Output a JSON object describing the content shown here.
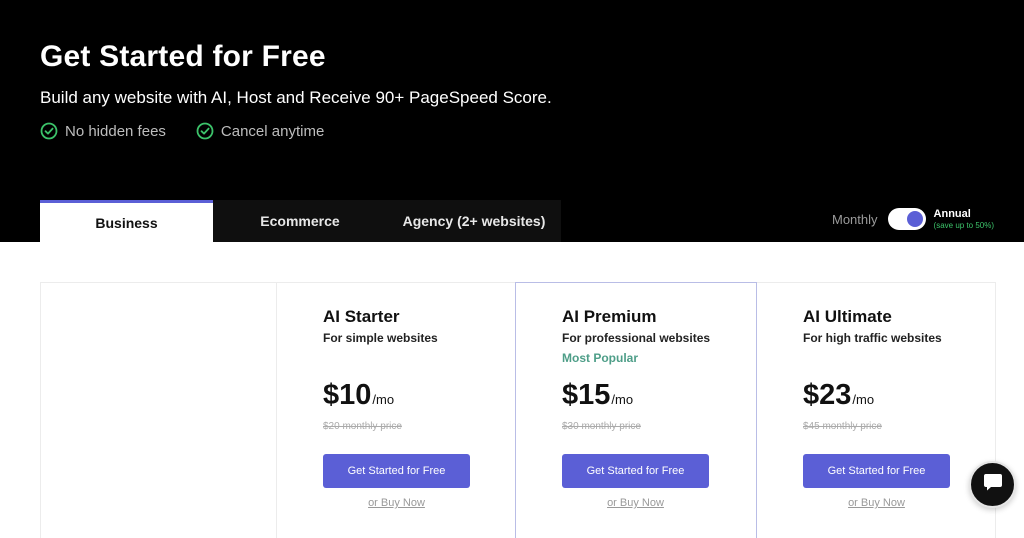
{
  "hero": {
    "title": "Get Started for Free",
    "subtitle": "Build any website with AI, Host and Receive 90+ PageSpeed Score.",
    "features": [
      {
        "label": "No hidden fees",
        "icon": "check-circle-icon"
      },
      {
        "label": "Cancel anytime",
        "icon": "check-circle-icon"
      }
    ]
  },
  "tabs": [
    {
      "label": "Business",
      "active": true
    },
    {
      "label": "Ecommerce",
      "active": false
    },
    {
      "label": "Agency (2+ websites)",
      "active": false
    }
  ],
  "billing": {
    "monthly_label": "Monthly",
    "annual_label": "Annual",
    "annual_note": "(save up to 50%)",
    "selected": "Annual"
  },
  "plans": [
    {
      "name": "AI Starter",
      "description": "For simple websites",
      "badge": "",
      "price": "$10",
      "unit": "/mo",
      "old_price": "$20 monthly price",
      "cta": "Get Started for Free",
      "buy": "or Buy Now"
    },
    {
      "name": "AI Premium",
      "description": "For professional websites",
      "badge": "Most Popular",
      "price": "$15",
      "unit": "/mo",
      "old_price": "$30 monthly price",
      "cta": "Get Started for Free",
      "buy": "or Buy Now"
    },
    {
      "name": "AI Ultimate",
      "description": "For high traffic websites",
      "badge": "",
      "price": "$23",
      "unit": "/mo",
      "old_price": "$45 monthly price",
      "cta": "Get Started for Free",
      "buy": "or Buy Now"
    }
  ],
  "chat": {
    "icon": "chat-bubble-icon"
  },
  "colors": {
    "hero_bg": "#000000",
    "accent": "#5b5fd6",
    "check": "#3cc36a",
    "badge": "#4e9e88"
  }
}
